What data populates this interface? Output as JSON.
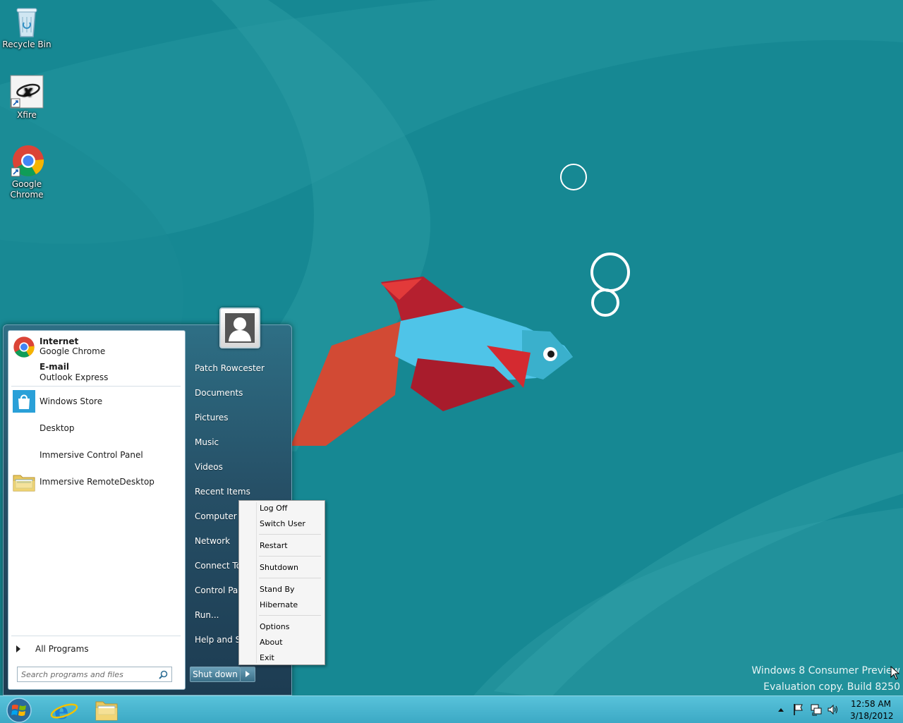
{
  "desktop": {
    "icons": [
      {
        "label": "Recycle Bin"
      },
      {
        "label": "Xfire"
      },
      {
        "label_line1": "Google",
        "label_line2": "Chrome"
      }
    ],
    "watermark": {
      "line1": "Windows 8 Consumer Preview",
      "line2": "Evaluation copy. Build 8250"
    }
  },
  "start_menu": {
    "pinned": [
      {
        "title": "Internet",
        "subtitle": "Google Chrome"
      },
      {
        "title": "E-mail",
        "subtitle": "Outlook Express"
      }
    ],
    "recent": [
      {
        "label": "Windows Store"
      },
      {
        "label": "Desktop"
      },
      {
        "label": "Immersive Control Panel"
      },
      {
        "label": "Immersive RemoteDesktop"
      }
    ],
    "all_programs": "All Programs",
    "search_placeholder": "Search programs and files",
    "right_items": [
      "Patch Rowcester",
      "Documents",
      "Pictures",
      "Music",
      "Videos",
      "Recent Items",
      "Computer",
      "Network",
      "Connect To",
      "Control Panel",
      "Run...",
      "Help and Support"
    ],
    "shutdown_label": "Shut down"
  },
  "context_menu": {
    "items": [
      "Log Off",
      "Switch User",
      "Restart",
      "Shutdown",
      "Stand By",
      "Hibernate",
      "Options",
      "About",
      "Exit"
    ]
  },
  "taskbar": {
    "clock_time": "12:58 AM",
    "clock_date": "3/18/2012"
  },
  "colors": {
    "wallpaper": "#168893",
    "taskbar": "#3ba8c4",
    "fish_blue": "#4fc4e8",
    "fish_red": "#b5202f"
  }
}
